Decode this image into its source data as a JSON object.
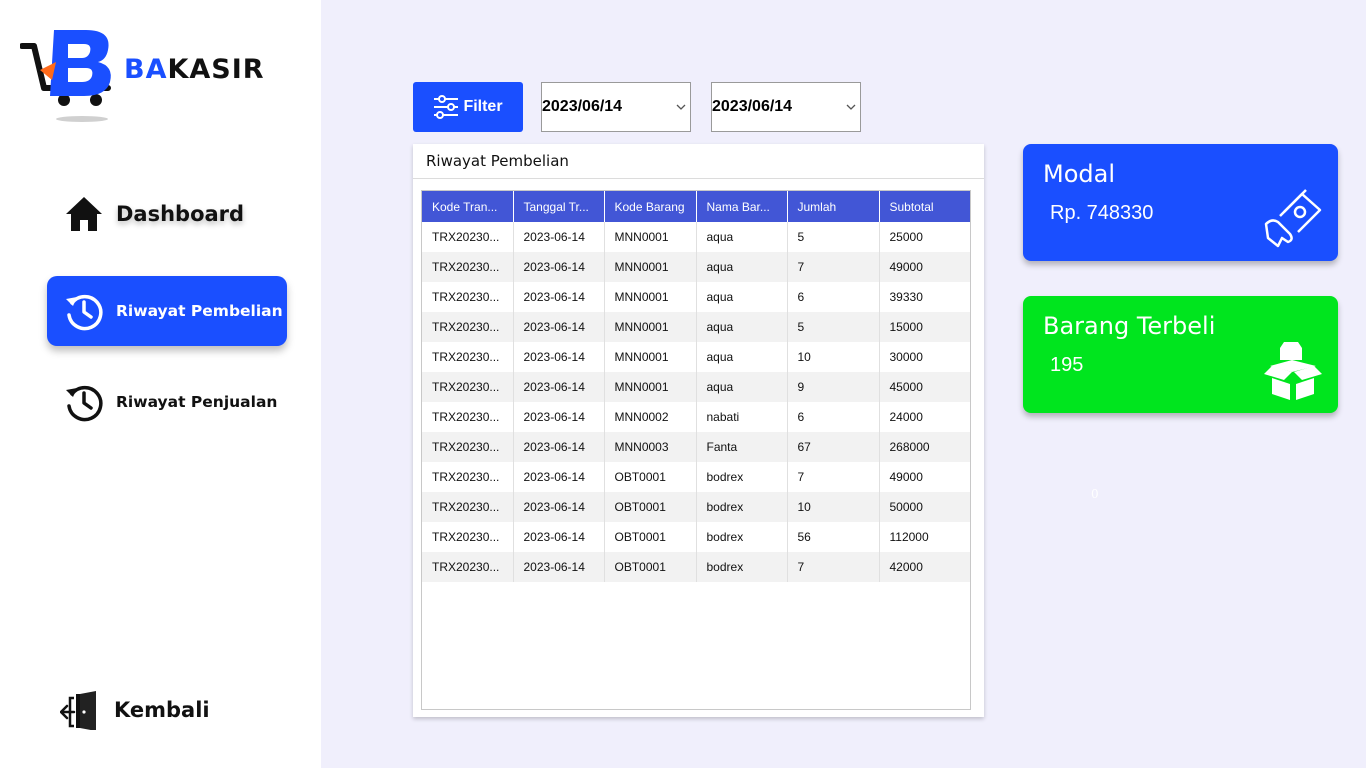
{
  "app": {
    "logo_text_ba": "BA",
    "logo_text_kasir": "KASIR"
  },
  "sidebar": {
    "items": [
      {
        "label": "Dashboard",
        "icon": "home-icon"
      },
      {
        "label": "Riwayat Pembelian",
        "icon": "history-icon",
        "active": true
      },
      {
        "label": "Riwayat Penjualan",
        "icon": "history-icon"
      },
      {
        "label": "Kembali",
        "icon": "exit-door-icon"
      }
    ]
  },
  "toolbar": {
    "filter_label": "Filter",
    "date_from": "2023/06/14",
    "date_to": "2023/06/14"
  },
  "panel": {
    "title": "Riwayat Pembelian",
    "columns": [
      "Kode Tran...",
      "Tanggal Tr...",
      "Kode Barang",
      "Nama Bar...",
      "Jumlah",
      "Subtotal"
    ],
    "rows": [
      [
        "TRX20230...",
        "2023-06-14",
        "MNN0001",
        "aqua",
        "5",
        "25000"
      ],
      [
        "TRX20230...",
        "2023-06-14",
        "MNN0001",
        "aqua",
        "7",
        "49000"
      ],
      [
        "TRX20230...",
        "2023-06-14",
        "MNN0001",
        "aqua",
        "6",
        "39330"
      ],
      [
        "TRX20230...",
        "2023-06-14",
        "MNN0001",
        "aqua",
        "5",
        "15000"
      ],
      [
        "TRX20230...",
        "2023-06-14",
        "MNN0001",
        "aqua",
        "10",
        "30000"
      ],
      [
        "TRX20230...",
        "2023-06-14",
        "MNN0001",
        "aqua",
        "9",
        "45000"
      ],
      [
        "TRX20230...",
        "2023-06-14",
        "MNN0002",
        "nabati",
        "6",
        "24000"
      ],
      [
        "TRX20230...",
        "2023-06-14",
        "MNN0003",
        "Fanta",
        "67",
        "268000"
      ],
      [
        "TRX20230...",
        "2023-06-14",
        "OBT0001",
        "bodrex",
        "7",
        "49000"
      ],
      [
        "TRX20230...",
        "2023-06-14",
        "OBT0001",
        "bodrex",
        "10",
        "50000"
      ],
      [
        "TRX20230...",
        "2023-06-14",
        "OBT0001",
        "bodrex",
        "56",
        "112000"
      ],
      [
        "TRX20230...",
        "2023-06-14",
        "OBT0001",
        "bodrex",
        "7",
        "42000"
      ]
    ]
  },
  "cards": {
    "modal": {
      "title": "Modal",
      "value": "Rp. 748330",
      "icon": "money-hand-icon",
      "color": "#1a4fff"
    },
    "barang": {
      "title": "Barang Terbeli",
      "value": "195",
      "icon": "open-box-icon",
      "color": "#00e51e"
    }
  },
  "stray_text": "0",
  "colors": {
    "accent": "#1a4fff",
    "table_header": "#4256d6",
    "background": "#f0effc",
    "success": "#00e51e"
  }
}
